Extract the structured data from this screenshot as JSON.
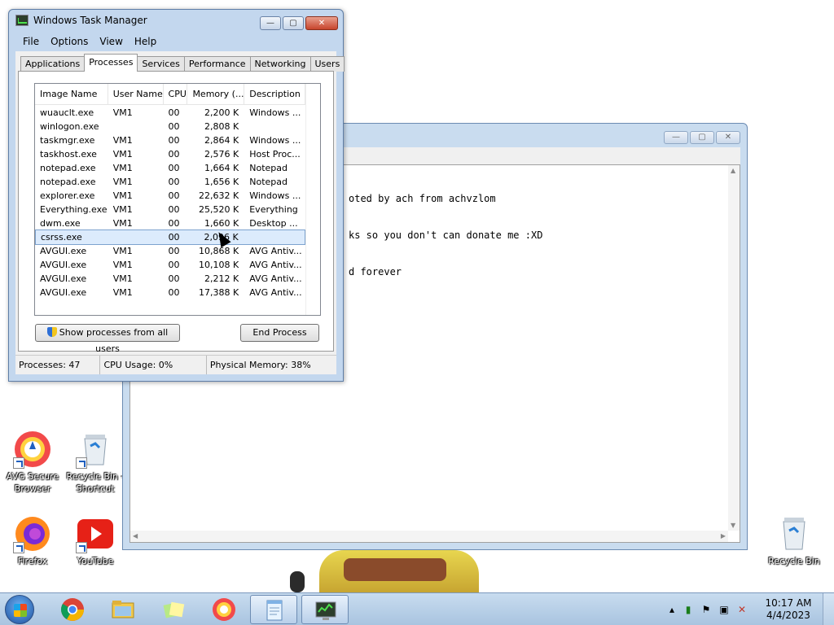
{
  "task_manager": {
    "title": "Windows Task Manager",
    "menu": [
      "File",
      "Options",
      "View",
      "Help"
    ],
    "tabs": [
      "Applications",
      "Processes",
      "Services",
      "Performance",
      "Networking",
      "Users"
    ],
    "active_tab": "Processes",
    "columns": [
      "Image Name",
      "User Name",
      "CPU",
      "Memory (...",
      "Description"
    ],
    "processes": [
      {
        "image": "wuauclt.exe",
        "user": "VM1",
        "cpu": "00",
        "memory": "2,200 K",
        "description": "Windows ..."
      },
      {
        "image": "winlogon.exe",
        "user": "",
        "cpu": "00",
        "memory": "2,808 K",
        "description": ""
      },
      {
        "image": "taskmgr.exe",
        "user": "VM1",
        "cpu": "00",
        "memory": "2,864 K",
        "description": "Windows ..."
      },
      {
        "image": "taskhost.exe",
        "user": "VM1",
        "cpu": "00",
        "memory": "2,576 K",
        "description": "Host Proc..."
      },
      {
        "image": "notepad.exe",
        "user": "VM1",
        "cpu": "00",
        "memory": "1,664 K",
        "description": "Notepad"
      },
      {
        "image": "notepad.exe",
        "user": "VM1",
        "cpu": "00",
        "memory": "1,656 K",
        "description": "Notepad"
      },
      {
        "image": "explorer.exe",
        "user": "VM1",
        "cpu": "00",
        "memory": "22,632 K",
        "description": "Windows ..."
      },
      {
        "image": "Everything.exe",
        "user": "VM1",
        "cpu": "00",
        "memory": "25,520 K",
        "description": "Everything"
      },
      {
        "image": "dwm.exe",
        "user": "VM1",
        "cpu": "00",
        "memory": "1,660 K",
        "description": "Desktop ..."
      },
      {
        "image": "csrss.exe",
        "user": "",
        "cpu": "00",
        "memory": "2,096 K",
        "description": ""
      },
      {
        "image": "AVGUI.exe",
        "user": "VM1",
        "cpu": "00",
        "memory": "10,868 K",
        "description": "AVG Antiv..."
      },
      {
        "image": "AVGUI.exe",
        "user": "VM1",
        "cpu": "00",
        "memory": "10,108 K",
        "description": "AVG Antiv..."
      },
      {
        "image": "AVGUI.exe",
        "user": "VM1",
        "cpu": "00",
        "memory": "2,212 K",
        "description": "AVG Antiv..."
      },
      {
        "image": "AVGUI.exe",
        "user": "VM1",
        "cpu": "00",
        "memory": "17,388 K",
        "description": "AVG Antiv..."
      }
    ],
    "selected_index": 9,
    "show_all_label": "Show processes from all users",
    "end_process_label": "End Process",
    "status": {
      "processes": "Processes: 47",
      "cpu": "CPU Usage: 0%",
      "memory": "Physical Memory: 38%"
    }
  },
  "notepad": {
    "lines": [
      "oted by ach from achvzlom",
      "ks so you don't can donate me :XD",
      "d forever"
    ]
  },
  "desktop_icons": [
    {
      "label": "AVG Secure Browser",
      "icon": "avg-browser-icon"
    },
    {
      "label": "Recycle Bin - Shortcut",
      "icon": "recycle-bin-icon"
    },
    {
      "label": "Firefox",
      "icon": "firefox-icon"
    },
    {
      "label": "YouTube",
      "icon": "youtube-icon"
    },
    {
      "label": "Recycle Bin",
      "icon": "recycle-bin-icon"
    }
  ],
  "taskbar": {
    "time": "10:17 AM",
    "date": "4/4/2023"
  },
  "colors": {
    "selection": "#dcebfc",
    "window_frame": "#c3d7ee",
    "taskbar": "#b9d0ea"
  }
}
